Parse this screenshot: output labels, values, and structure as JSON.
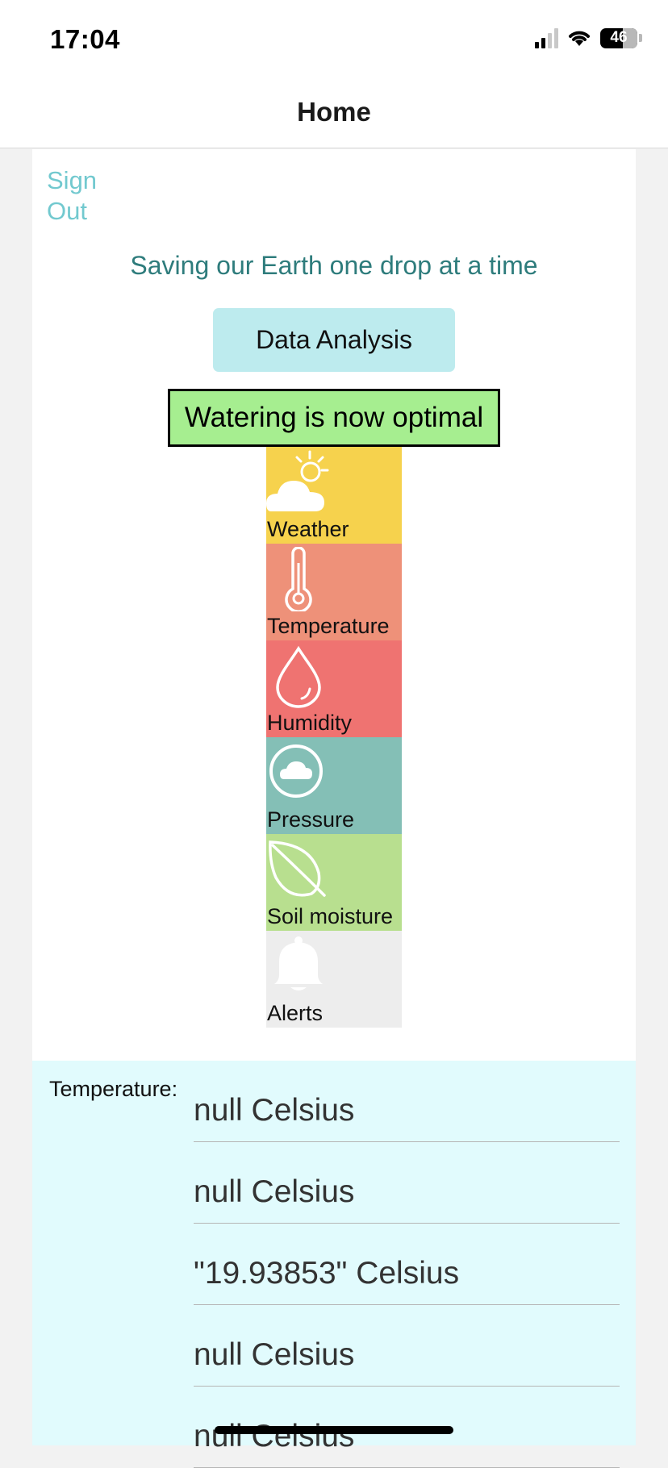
{
  "status_bar": {
    "time": "17:04",
    "battery": "46"
  },
  "nav": {
    "title": "Home"
  },
  "main": {
    "sign_out": "Sign Out",
    "tagline": "Saving our Earth one drop at a time",
    "data_analysis_label": "Data Analysis",
    "watering_status": "Watering is now optimal"
  },
  "tiles": [
    {
      "label": "Weather",
      "icon": "weather-icon",
      "color": "#f6d24d"
    },
    {
      "label": "Temperature",
      "icon": "thermometer-icon",
      "color": "#ee9179"
    },
    {
      "label": "Humidity",
      "icon": "droplet-icon",
      "color": "#ef7371"
    },
    {
      "label": "Pressure",
      "icon": "pressure-icon",
      "color": "#84bfb6"
    },
    {
      "label": "Soil moisture",
      "icon": "leaf-icon",
      "color": "#b8df8f"
    },
    {
      "label": "Alerts",
      "icon": "bell-icon",
      "color": "#ededed"
    }
  ],
  "temperature": {
    "label": "Temperature:",
    "readings": [
      "null Celsius",
      "null Celsius",
      "\"19.93853\" Celsius",
      "null Celsius",
      "null Celsius"
    ]
  },
  "colors": {
    "accent": "#72c9cf",
    "tagline": "#2e7c7c",
    "button_bg": "#bdebee",
    "watering_bg": "#a6ee90",
    "temp_section_bg": "#e1fbfd"
  }
}
